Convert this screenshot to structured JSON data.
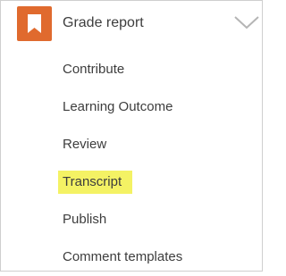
{
  "header": {
    "title": "Grade report",
    "icon": "bookmark-icon",
    "toggle_icon": "chevron-down-icon",
    "icon_color": "#e06a2e"
  },
  "menu": {
    "items": [
      {
        "label": "Contribute",
        "highlighted": false
      },
      {
        "label": "Learning Outcome",
        "highlighted": false
      },
      {
        "label": "Review",
        "highlighted": false
      },
      {
        "label": "Transcript",
        "highlighted": true
      },
      {
        "label": "Publish",
        "highlighted": false
      },
      {
        "label": "Comment templates",
        "highlighted": false
      }
    ],
    "highlight_color": "#f4f264"
  }
}
